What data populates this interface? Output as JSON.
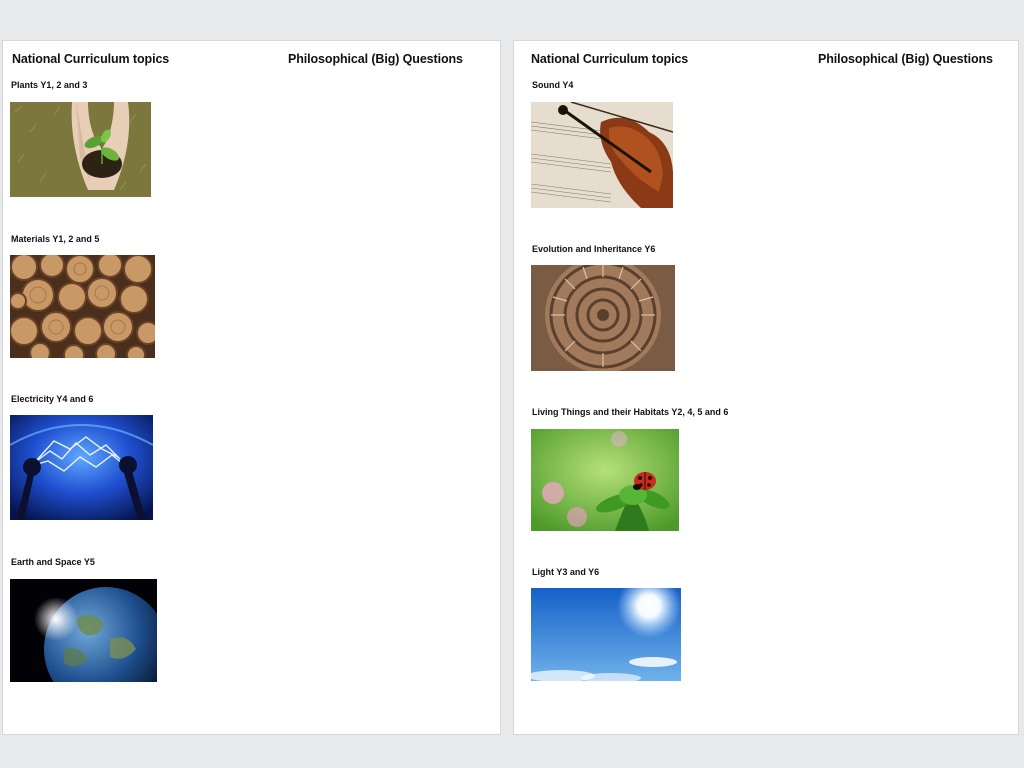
{
  "left_page": {
    "heading_topics": "National Curriculum topics",
    "heading_questions": "Philosophical (Big) Questions",
    "topics": [
      {
        "label": "Plants Y1, 2 and 3",
        "image_icon": "seedling-in-hands-photo"
      },
      {
        "label": "Materials  Y1, 2 and 5",
        "image_icon": "stacked-logs-photo"
      },
      {
        "label": "Electricity Y4 and 6",
        "image_icon": "electric-arc-photo"
      },
      {
        "label": "Earth and Space Y5",
        "image_icon": "earth-from-space-photo"
      }
    ]
  },
  "right_page": {
    "heading_topics": "National Curriculum topics",
    "heading_questions": "Philosophical (Big) Questions",
    "topics": [
      {
        "label": "Sound Y4",
        "image_icon": "violin-sheet-music-photo"
      },
      {
        "label": "Evolution and Inheritance Y6",
        "image_icon": "ammonite-fossil-photo"
      },
      {
        "label": "Living Things and their Habitats Y2, 4, 5 and 6",
        "image_icon": "ladybird-on-leaf-photo"
      },
      {
        "label": "Light Y3 and Y6",
        "image_icon": "sun-in-sky-photo"
      }
    ]
  }
}
